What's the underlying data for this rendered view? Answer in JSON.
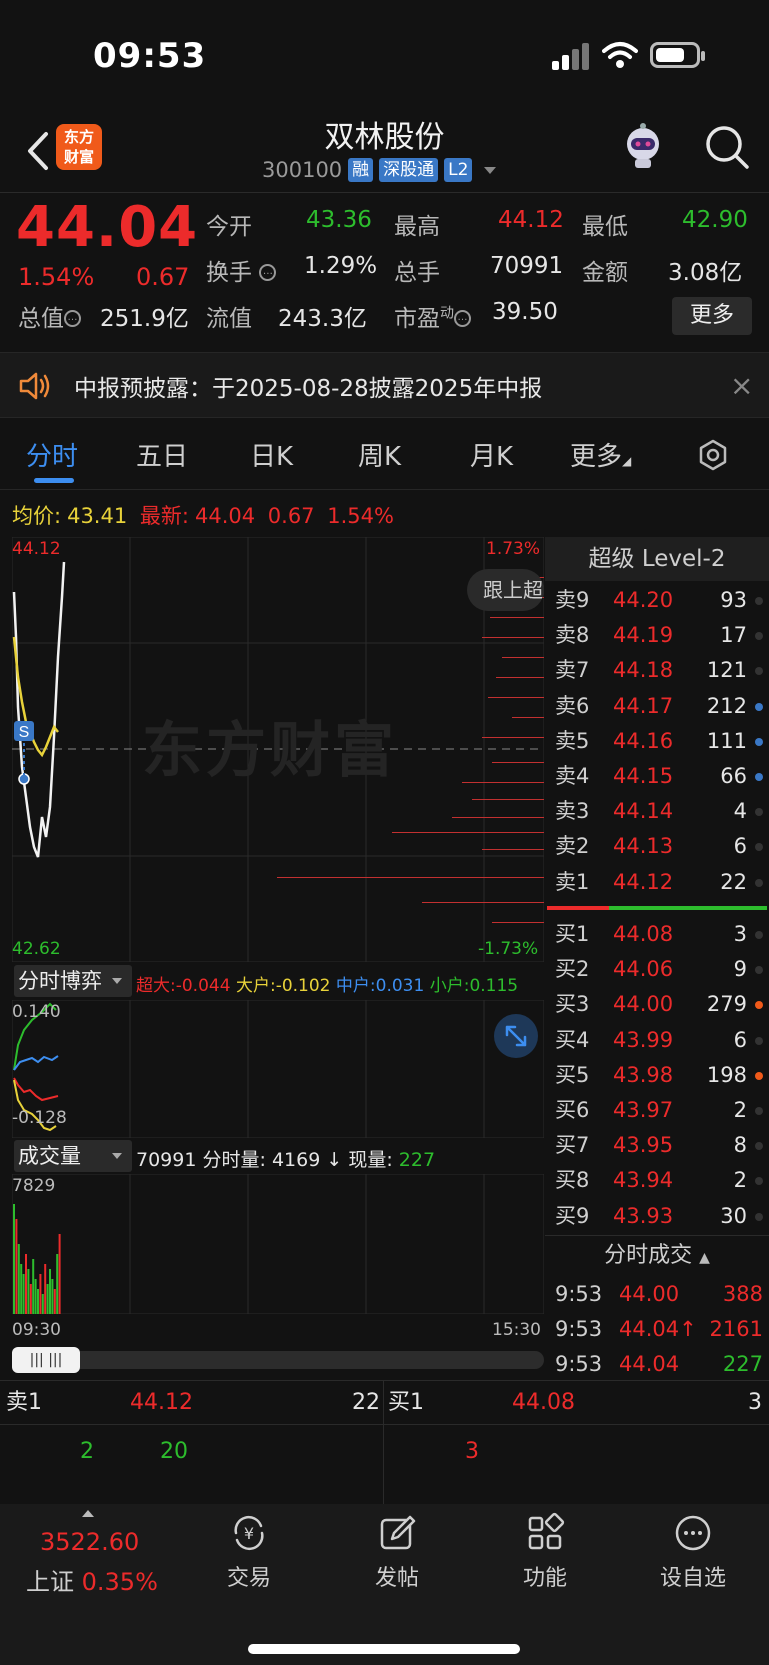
{
  "status_bar": {
    "time": "09:53"
  },
  "header": {
    "logo_text_1": "东方",
    "logo_text_2": "财富",
    "stock_name": "双林股份",
    "stock_code": "300100",
    "tags": [
      "融",
      "深股通",
      "L2"
    ]
  },
  "quote": {
    "price": "44.04",
    "change_pct": "1.54%",
    "change": "0.67",
    "open_label": "今开",
    "open": "43.36",
    "high_label": "最高",
    "high": "44.12",
    "low_label": "最低",
    "low": "42.90",
    "turnover_label": "换手",
    "turnover": "1.29%",
    "volume_label": "总手",
    "volume": "70991",
    "amount_label": "金额",
    "amount": "3.08亿",
    "mktcap_label": "总值",
    "mktcap": "251.9亿",
    "float_label": "流值",
    "float": "243.3亿",
    "pe_label": "市盈",
    "pe_sup": "动",
    "pe": "39.50",
    "more_label": "更多"
  },
  "notice": {
    "text": "中报预披露：于2025-08-28披露2025年中报",
    "close": "×"
  },
  "tabs": [
    "分时",
    "五日",
    "日K",
    "周K",
    "月K",
    "更多"
  ],
  "avg": {
    "avg_label": "均价:",
    "avg_value": "43.41",
    "latest_label": "最新:",
    "latest_value": "44.04",
    "latest_change": "0.67",
    "latest_pct": "1.54%"
  },
  "chart": {
    "y_top": "44.12",
    "y_bottom": "42.62",
    "pct_top": "1.73%",
    "pct_bottom": "-1.73%",
    "watermark": "东方财富",
    "follow_label": "跟上超",
    "s_marker": "S"
  },
  "game": {
    "label": "分时博弈",
    "super_label": "超大:",
    "super": "-0.044",
    "big_label": "大户:",
    "big": "-0.102",
    "mid_label": "中户:",
    "mid": "0.031",
    "small_label": "小户:",
    "small": "0.115",
    "y_top": "0.140",
    "y_bottom": "-0.128"
  },
  "volume": {
    "label": "成交量",
    "total": "70991",
    "per_label": "分时量:",
    "per": "4169",
    "now_label": "现量:",
    "now": "227",
    "y_top": "7829",
    "x_start": "09:30",
    "x_end": "15:30"
  },
  "orderbook": {
    "title": "超级 Level-2",
    "asks": [
      {
        "label": "卖9",
        "price": "44.20",
        "vol": "93",
        "dot": ""
      },
      {
        "label": "卖8",
        "price": "44.19",
        "vol": "17",
        "dot": ""
      },
      {
        "label": "卖7",
        "price": "44.18",
        "vol": "121",
        "dot": ""
      },
      {
        "label": "卖6",
        "price": "44.17",
        "vol": "212",
        "dot": "blue"
      },
      {
        "label": "卖5",
        "price": "44.16",
        "vol": "111",
        "dot": "blue"
      },
      {
        "label": "卖4",
        "price": "44.15",
        "vol": "66",
        "dot": "blue"
      },
      {
        "label": "卖3",
        "price": "44.14",
        "vol": "4",
        "dot": ""
      },
      {
        "label": "卖2",
        "price": "44.13",
        "vol": "6",
        "dot": ""
      },
      {
        "label": "卖1",
        "price": "44.12",
        "vol": "22",
        "dot": ""
      }
    ],
    "bids": [
      {
        "label": "买1",
        "price": "44.08",
        "vol": "3",
        "dot": ""
      },
      {
        "label": "买2",
        "price": "44.06",
        "vol": "9",
        "dot": ""
      },
      {
        "label": "买3",
        "price": "44.00",
        "vol": "279",
        "dot": "orange"
      },
      {
        "label": "买4",
        "price": "43.99",
        "vol": "6",
        "dot": ""
      },
      {
        "label": "买5",
        "price": "43.98",
        "vol": "198",
        "dot": "orange"
      },
      {
        "label": "买6",
        "price": "43.97",
        "vol": "2",
        "dot": ""
      },
      {
        "label": "买7",
        "price": "43.95",
        "vol": "8",
        "dot": ""
      },
      {
        "label": "买8",
        "price": "43.94",
        "vol": "2",
        "dot": ""
      },
      {
        "label": "买9",
        "price": "43.93",
        "vol": "30",
        "dot": ""
      }
    ],
    "trades_title": "分时成交",
    "trades": [
      {
        "time": "9:53",
        "price": "44.00",
        "vol": "388",
        "color": "red"
      },
      {
        "time": "9:53",
        "price": "44.04↑",
        "vol": "2161",
        "color": "red"
      },
      {
        "time": "9:53",
        "price": "44.04",
        "vol": "227",
        "color": "green"
      }
    ]
  },
  "strip": {
    "ask_label": "卖1",
    "ask_price": "44.12",
    "ask_vol": "22",
    "bid_label": "买1",
    "bid_price": "44.08",
    "bid_vol": "3",
    "ask_q1": "2",
    "ask_q2": "20",
    "bid_q1": "3"
  },
  "bottom_nav": {
    "index_value": "3522.60",
    "index_name": "上证",
    "index_pct": "0.35%",
    "items": [
      "交易",
      "发帖",
      "功能",
      "设自选"
    ]
  }
}
